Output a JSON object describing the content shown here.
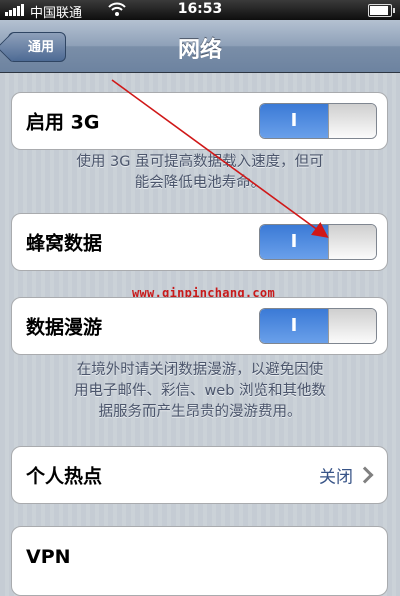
{
  "status_bar": {
    "carrier": "中国联通",
    "time": "16:53",
    "icons": [
      "signal-bars-icon",
      "wifi-icon",
      "battery-icon"
    ]
  },
  "nav": {
    "back_label": "通用",
    "title": "网络"
  },
  "settings": {
    "enable_3g": {
      "label": "启用 3G",
      "state": "on",
      "toggle_text": "I"
    },
    "enable_3g_note": [
      "使用 3G 虽可提高数据载入速度，但可",
      "能会降低电池寿命。"
    ],
    "cellular_data": {
      "label": "蜂窝数据",
      "state": "on",
      "toggle_text": "I"
    },
    "data_roaming": {
      "label": "数据漫游",
      "state": "on",
      "toggle_text": "I"
    },
    "roaming_note": [
      "在境外时请关闭数据漫游，以避免因使",
      "用电子邮件、彩信、web 浏览和其他数",
      "据服务而产生昂贵的漫游费用。"
    ],
    "personal_hotspot": {
      "label": "个人热点",
      "value": "关闭"
    },
    "vpn": {
      "label": "VPN"
    }
  },
  "watermark": "www.qinpinchang.com",
  "colors": {
    "toggle_on": "#3b7ad6",
    "annotation_arrow": "#d01818",
    "value_text": "#385487"
  }
}
